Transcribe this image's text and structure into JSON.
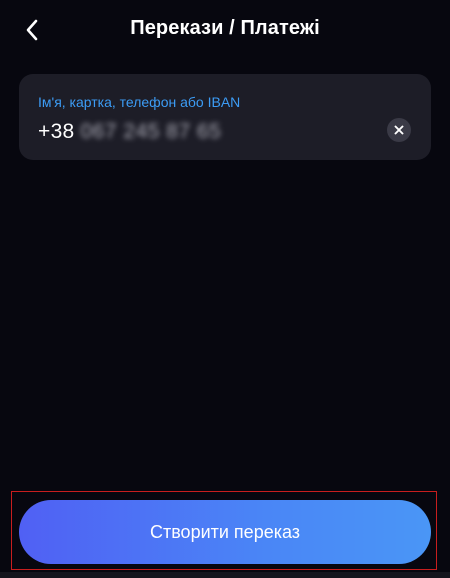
{
  "header": {
    "title": "Перекази / Платежі",
    "back_icon": "chevron-left-icon"
  },
  "recipient_field": {
    "label": "Ім'я, картка, телефон або IBAN",
    "value_prefix": "+38",
    "value_masked": "067 245 87 65",
    "clear_icon": "close-icon"
  },
  "action": {
    "create_label": "Створити переказ"
  },
  "colors": {
    "background": "#07070f",
    "field_background": "#1d1d27",
    "label_accent": "#3c9cf5",
    "button_gradient_start": "#5060f4",
    "button_gradient_end": "#4a96f6",
    "highlight_border": "#c81e1e"
  }
}
